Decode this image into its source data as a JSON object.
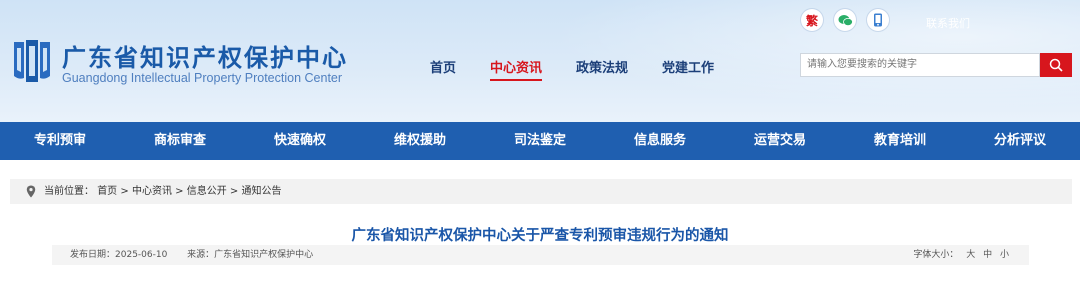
{
  "header": {
    "site_title": "广东省知识产权保护中心",
    "site_subtitle": "Guangdong Intellectual Property Protection Center",
    "traditional_label": "繁",
    "contact_label": "联系我们",
    "search_placeholder": "请输入您要搜索的关键字",
    "top_nav": [
      {
        "label": "首页"
      },
      {
        "label": "中心资讯"
      },
      {
        "label": "政策法规"
      },
      {
        "label": "党建工作"
      }
    ]
  },
  "main_nav": [
    {
      "label": "专利预审"
    },
    {
      "label": "商标审查"
    },
    {
      "label": "快速确权"
    },
    {
      "label": "维权援助"
    },
    {
      "label": "司法鉴定"
    },
    {
      "label": "信息服务"
    },
    {
      "label": "运营交易"
    },
    {
      "label": "教育培训"
    },
    {
      "label": "分析评议"
    }
  ],
  "breadcrumb": {
    "prefix": "当前位置：",
    "items": [
      "首页",
      "中心资讯",
      "信息公开",
      "通知公告"
    ],
    "separator": ">"
  },
  "article": {
    "title": "广东省知识产权保护中心关于严查专利预审违规行为的通知",
    "date_label": "发布日期：",
    "date": "2025-06-10",
    "source_label": "来源：",
    "source": "广东省知识产权保护中心",
    "font_size_label": "字体大小：",
    "font_sizes": [
      "大",
      "中",
      "小"
    ]
  },
  "colors": {
    "brand_blue": "#1f5fb0",
    "accent_red": "#d7161d",
    "wechat_green": "#2aae67",
    "mobile_blue": "#3b7fd0"
  },
  "icons": {
    "logo": "ip-center-logo",
    "wechat": "wechat-icon",
    "mobile": "mobile-icon",
    "search": "search-icon",
    "location": "location-pin-icon"
  }
}
